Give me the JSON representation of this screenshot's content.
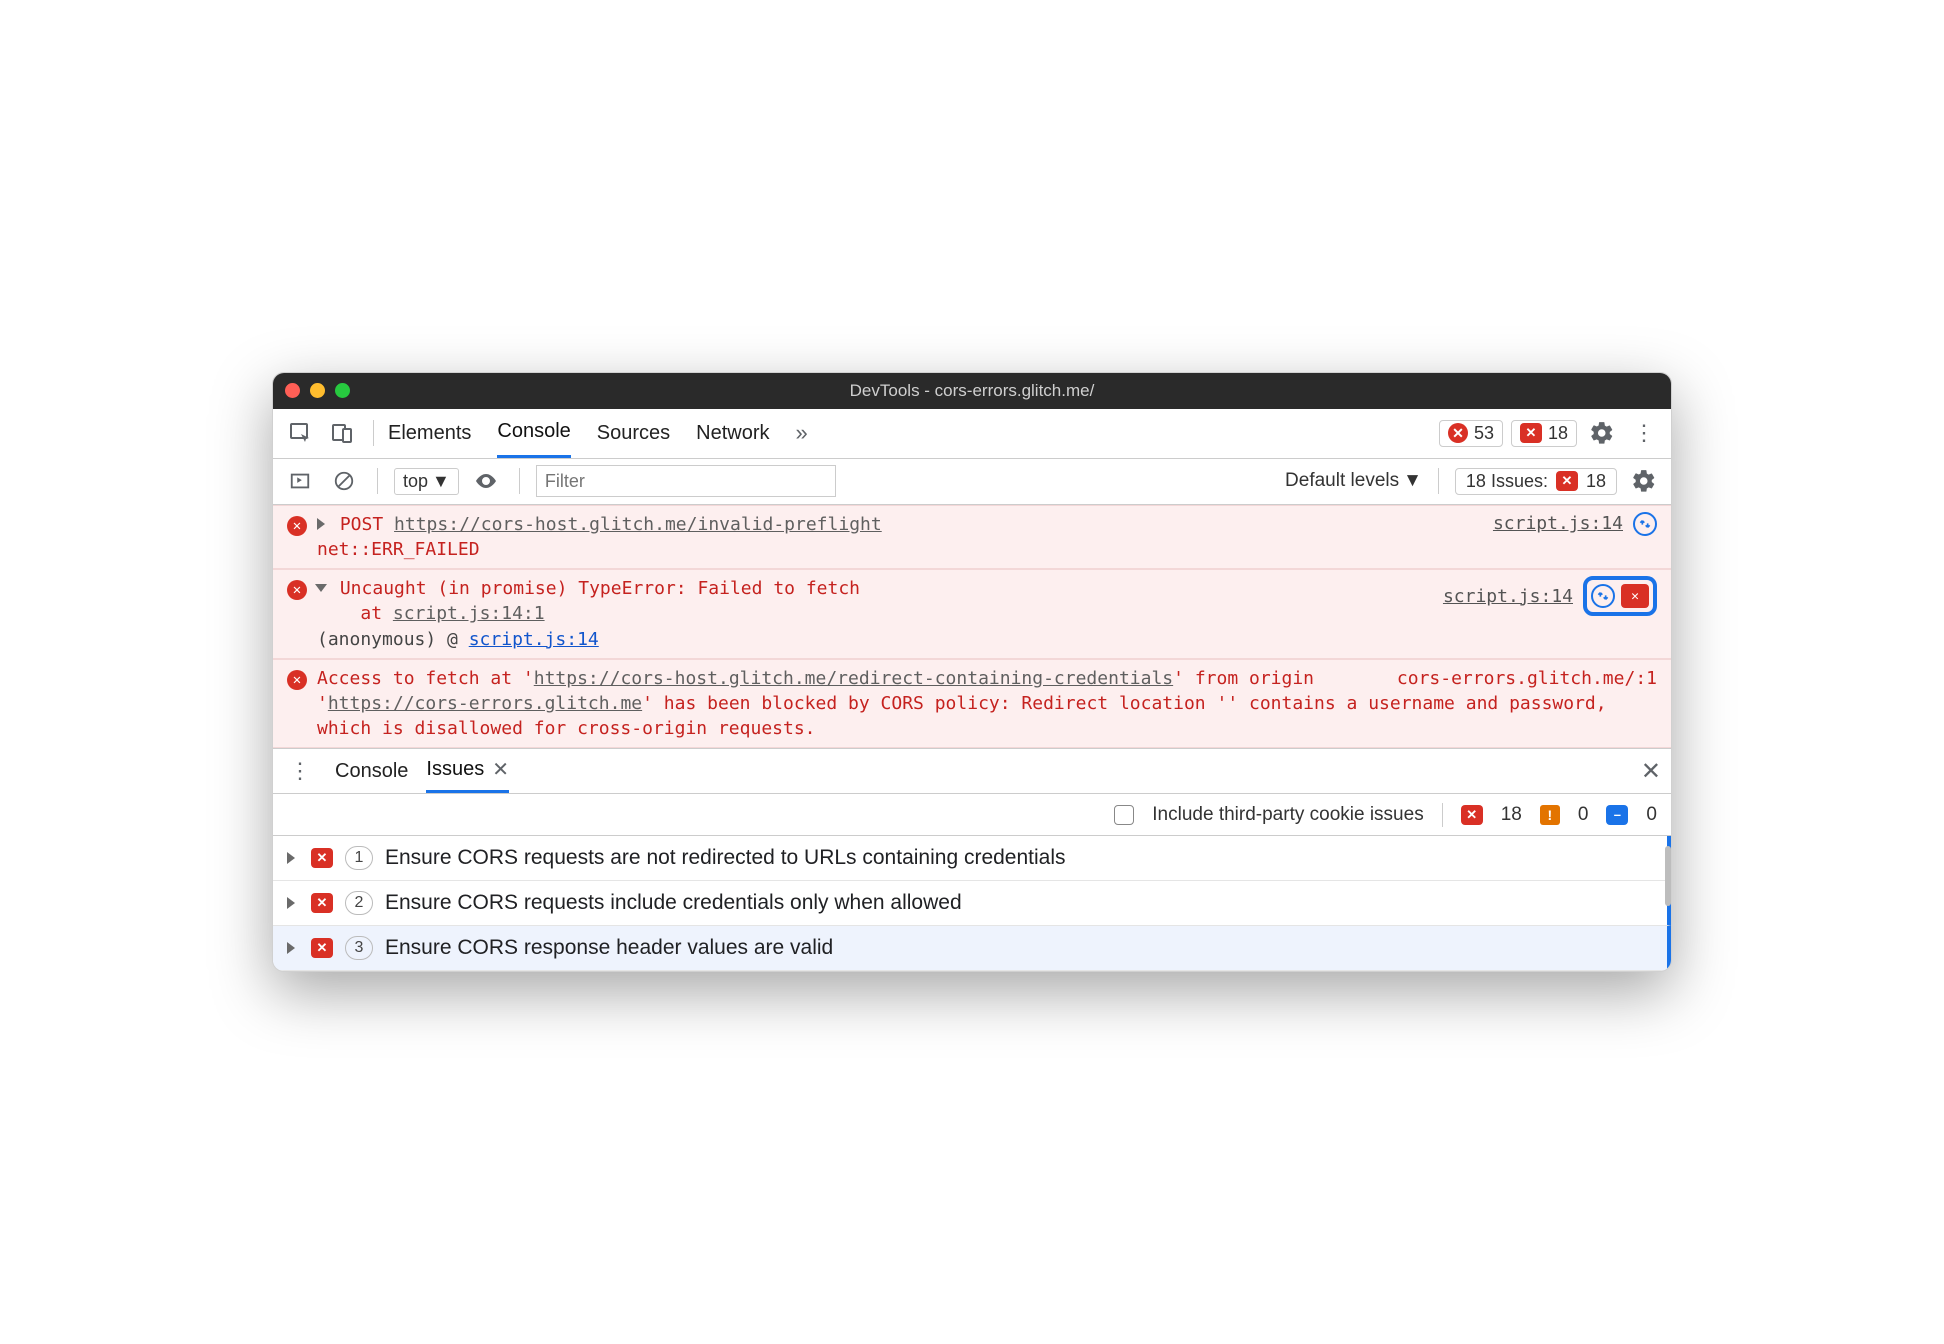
{
  "window": {
    "title": "DevTools - cors-errors.glitch.me/"
  },
  "main_tabs": {
    "elements": "Elements",
    "console": "Console",
    "sources": "Sources",
    "network": "Network"
  },
  "counts": {
    "errors": "53",
    "issues": "18"
  },
  "sub": {
    "context": "top",
    "filter_placeholder": "Filter",
    "levels": "Default levels",
    "issues_label": "18 Issues:",
    "issues_count": "18"
  },
  "console_rows": {
    "r1": {
      "method": "POST",
      "url": "https://cors-host.glitch.me/invalid-preflight",
      "err": "net::ERR_FAILED",
      "src": "script.js:14"
    },
    "r2": {
      "msg": "Uncaught (in promise) TypeError: Failed to fetch",
      "at": "at ",
      "atlink": "script.js:14:1",
      "anon": "(anonymous) @ ",
      "anlink": "script.js:14",
      "src": "script.js:14"
    },
    "r3": {
      "p1": "Access to fetch at '",
      "link1": "https://cors-host.glitch.me/redirect-containing-credentials",
      "p2": "' from origin '",
      "link2": "https://cors-errors.glitch.me",
      "p3": "' has been blocked by CORS policy: Redirect location '' contains a username and password, which is disallowed for cross-origin requests.",
      "src": "cors-errors.glitch.me/:1"
    }
  },
  "drawer": {
    "tab_console": "Console",
    "tab_issues": "Issues",
    "include_label": "Include third-party cookie issues",
    "counts": {
      "err": "18",
      "warn": "0",
      "info": "0"
    }
  },
  "issues": [
    {
      "count": "1",
      "text": "Ensure CORS requests are not redirected to URLs containing credentials"
    },
    {
      "count": "2",
      "text": "Ensure CORS requests include credentials only when allowed"
    },
    {
      "count": "3",
      "text": "Ensure CORS response header values are valid"
    }
  ]
}
